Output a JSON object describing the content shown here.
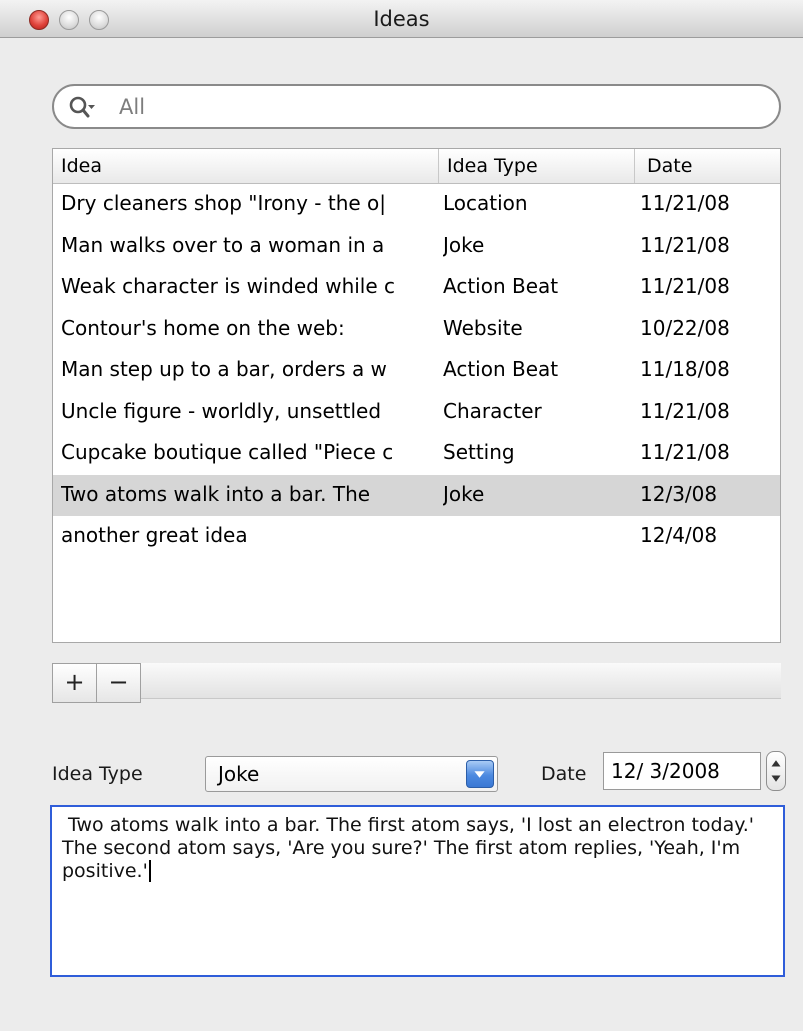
{
  "window": {
    "title": "Ideas"
  },
  "search": {
    "placeholder": "All",
    "value": ""
  },
  "table": {
    "columns": [
      "Idea",
      "Idea Type",
      "Date"
    ],
    "rows": [
      {
        "idea": "Dry cleaners shop \"Irony - the o|",
        "type": "Location",
        "date": "11/21/08",
        "selected": false
      },
      {
        "idea": "Man walks over to a woman in a",
        "type": "Joke",
        "date": "11/21/08",
        "selected": false
      },
      {
        "idea": "Weak character is winded while c",
        "type": "Action Beat",
        "date": "11/21/08",
        "selected": false
      },
      {
        "idea": "Contour's home on the web:",
        "type": "Website",
        "date": "10/22/08",
        "selected": false
      },
      {
        "idea": "Man step up to a bar, orders a w",
        "type": "Action Beat",
        "date": "11/18/08",
        "selected": false
      },
      {
        "idea": "Uncle figure - worldly, unsettled",
        "type": "Character",
        "date": "11/21/08",
        "selected": false
      },
      {
        "idea": "Cupcake boutique called \"Piece c",
        "type": "Setting",
        "date": "11/21/08",
        "selected": false
      },
      {
        "idea": " Two atoms walk into a bar. The",
        "type": "Joke",
        "date": "12/3/08",
        "selected": true
      },
      {
        "idea": "another great idea",
        "type": "",
        "date": "12/4/08",
        "selected": false
      }
    ]
  },
  "buttons": {
    "add": "+",
    "remove": "−"
  },
  "form": {
    "idea_type_label": "Idea Type",
    "idea_type_value": "Joke",
    "date_label": "Date",
    "date_value": "12/ 3/2008",
    "text": " Two atoms walk into a bar. The first atom says, 'I lost an electron today.' The second atom says, 'Are you sure?' The first atom replies, 'Yeah, I'm positive.'"
  },
  "colors": {
    "selection": "#d6d6d6",
    "focus_ring": "#2f5dd9",
    "popup_accent": "#4d8ae0"
  }
}
